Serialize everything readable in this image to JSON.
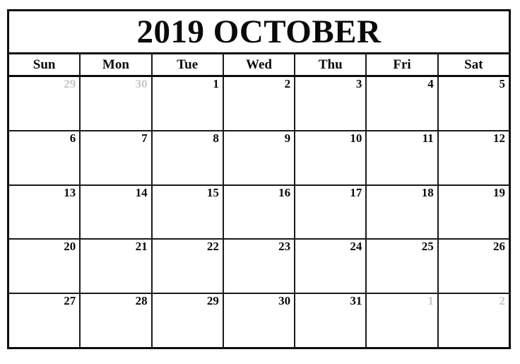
{
  "calendar": {
    "title": "2019 OCTOBER",
    "year": "2019",
    "month": "OCTOBER",
    "weekdays": [
      {
        "short": "Sun"
      },
      {
        "short": "Mon"
      },
      {
        "short": "Tue"
      },
      {
        "short": "Wed"
      },
      {
        "short": "Thu"
      },
      {
        "short": "Fri"
      },
      {
        "short": "Sat"
      }
    ],
    "colors": {
      "border": "#0d0d0d",
      "grid_line": "#1a1a1a",
      "text": "#0a0a0a",
      "other_month_text": "#c8c8c8",
      "background": "#ffffff"
    },
    "weeks": [
      {
        "days": [
          {
            "label": "29",
            "in_month": false
          },
          {
            "label": "30",
            "in_month": false
          },
          {
            "label": "1",
            "in_month": true
          },
          {
            "label": "2",
            "in_month": true
          },
          {
            "label": "3",
            "in_month": true
          },
          {
            "label": "4",
            "in_month": true
          },
          {
            "label": "5",
            "in_month": true
          }
        ]
      },
      {
        "days": [
          {
            "label": "6",
            "in_month": true
          },
          {
            "label": "7",
            "in_month": true
          },
          {
            "label": "8",
            "in_month": true
          },
          {
            "label": "9",
            "in_month": true
          },
          {
            "label": "10",
            "in_month": true
          },
          {
            "label": "11",
            "in_month": true
          },
          {
            "label": "12",
            "in_month": true
          }
        ]
      },
      {
        "days": [
          {
            "label": "13",
            "in_month": true
          },
          {
            "label": "14",
            "in_month": true
          },
          {
            "label": "15",
            "in_month": true
          },
          {
            "label": "16",
            "in_month": true
          },
          {
            "label": "17",
            "in_month": true
          },
          {
            "label": "18",
            "in_month": true
          },
          {
            "label": "19",
            "in_month": true
          }
        ]
      },
      {
        "days": [
          {
            "label": "20",
            "in_month": true
          },
          {
            "label": "21",
            "in_month": true
          },
          {
            "label": "22",
            "in_month": true
          },
          {
            "label": "23",
            "in_month": true
          },
          {
            "label": "24",
            "in_month": true
          },
          {
            "label": "25",
            "in_month": true
          },
          {
            "label": "26",
            "in_month": true
          }
        ]
      },
      {
        "days": [
          {
            "label": "27",
            "in_month": true
          },
          {
            "label": "28",
            "in_month": true
          },
          {
            "label": "29",
            "in_month": true
          },
          {
            "label": "30",
            "in_month": true
          },
          {
            "label": "31",
            "in_month": true
          },
          {
            "label": "1",
            "in_month": false
          },
          {
            "label": "2",
            "in_month": false
          }
        ]
      }
    ]
  }
}
